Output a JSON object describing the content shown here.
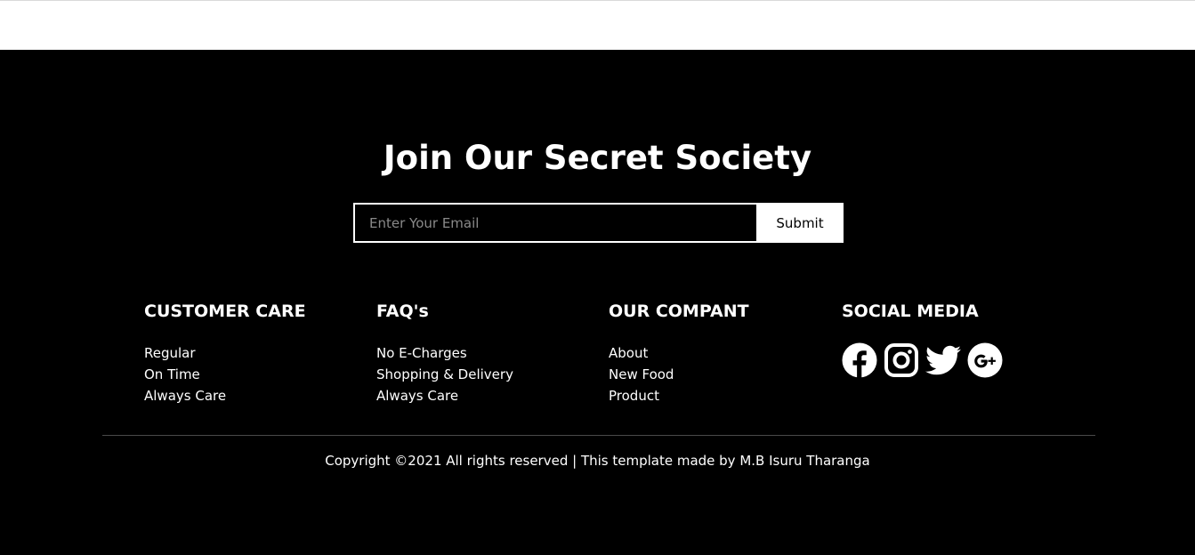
{
  "newsletter": {
    "title": "Join Our Secret Society",
    "email_placeholder": "Enter Your Email",
    "submit_label": "Submit"
  },
  "columns": [
    {
      "title": "CUSTOMER CARE",
      "links": [
        "Regular",
        "On Time",
        "Always Care"
      ]
    },
    {
      "title": "FAQ's",
      "links": [
        "No E-Charges",
        "Shopping & Delivery",
        "Always Care"
      ]
    },
    {
      "title": "OUR COMPANT",
      "links": [
        "About",
        "New Food",
        "Product"
      ]
    }
  ],
  "social": {
    "title": "SOCIAL MEDIA",
    "icons": [
      "facebook-icon",
      "instagram-icon",
      "twitter-icon",
      "google-plus-icon"
    ]
  },
  "copyright": "Copyright ©2021 All rights reserved | This template made by M.B Isuru Tharanga",
  "colors": {
    "background": "#000000",
    "text": "#ffffff",
    "placeholder": "#8a8a8a"
  }
}
